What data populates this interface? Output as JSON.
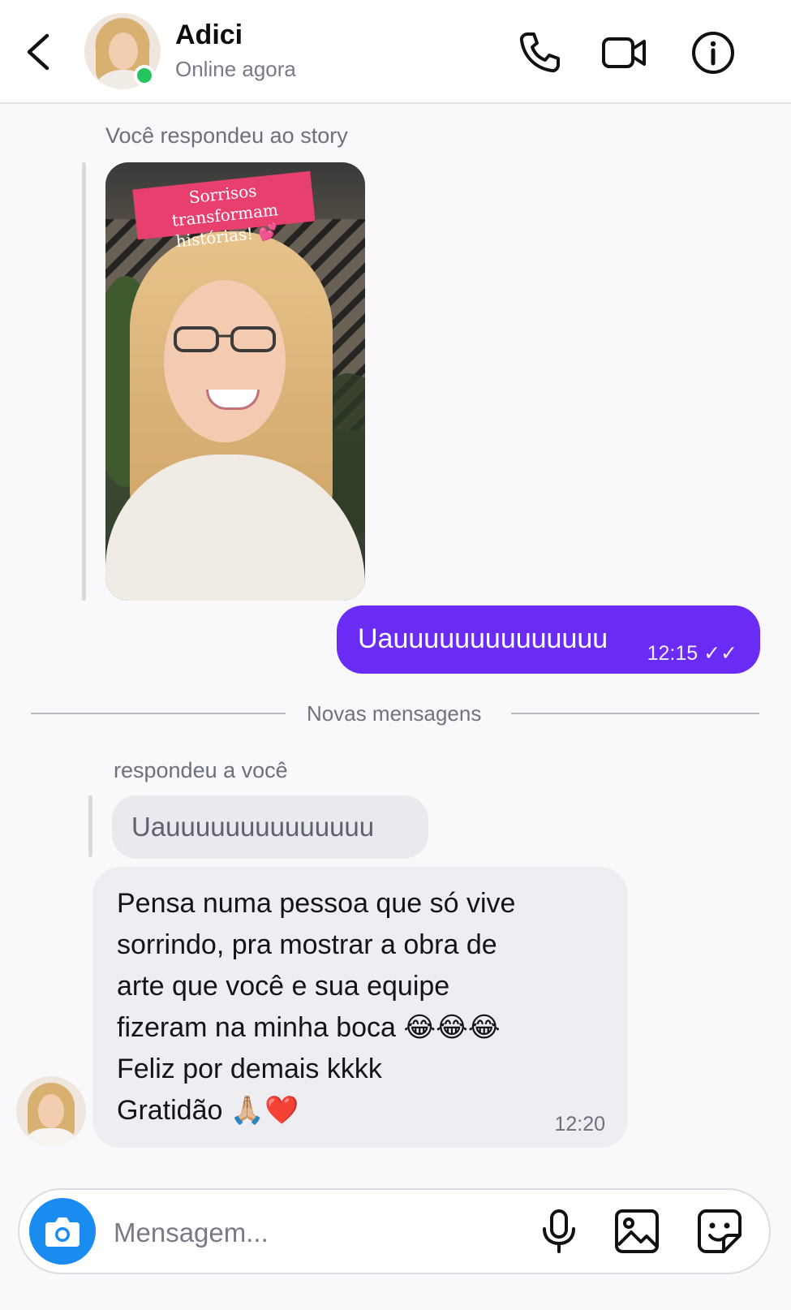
{
  "header": {
    "contact_name": "Adici",
    "status": "Online agora",
    "icons": [
      "back-arrow-icon",
      "phone-icon",
      "video-icon",
      "info-icon"
    ]
  },
  "conversation": {
    "story_reply_label": "Você respondeu ao story",
    "story_sticker_line1": "Sorrisos transformam",
    "story_sticker_line2": "histórias! 💕",
    "sent_message": {
      "text": "Uauuuuuuuuuuuuuu",
      "time": "12:15 ✓✓"
    },
    "divider_label": "Novas mensagens",
    "reply_label": "respondeu a você",
    "quoted_text": "Uauuuuuuuuuuuuuu",
    "received_message": {
      "text": "Pensa numa pessoa que só vive\nsorrindo, pra mostrar a obra de\narte que você e sua equipe\nfizeram na minha boca 😂😂😂\nFeliz por demais kkkk\nGratidão 🙏🏼❤️",
      "time": "12:20"
    }
  },
  "composer": {
    "placeholder": "Mensagem...",
    "icons": [
      "camera-icon",
      "microphone-icon",
      "image-icon",
      "sticker-icon"
    ]
  },
  "colors": {
    "accent": "#6a2cf5",
    "camera_blue": "#1a8cf0",
    "online_green": "#22c55e",
    "received_bubble": "#eeeef2"
  }
}
